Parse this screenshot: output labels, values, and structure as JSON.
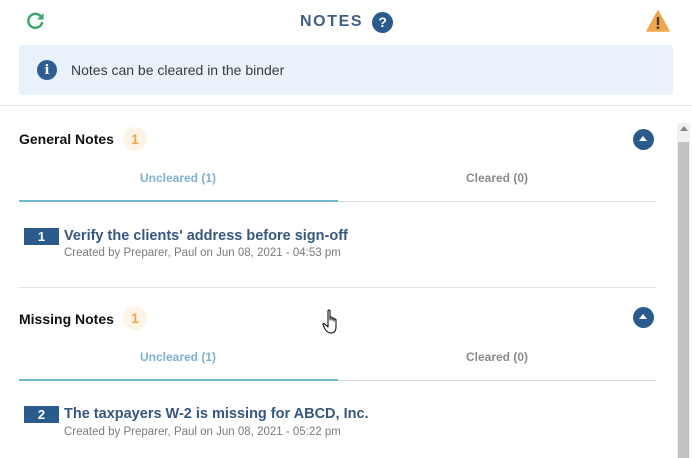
{
  "header": {
    "title": "NOTES",
    "help_icon": "?"
  },
  "banner": {
    "text": "Notes can be cleared in the binder",
    "icon": "i"
  },
  "sections": [
    {
      "title": "General Notes",
      "count": "1",
      "tabs": [
        "Uncleared (1)",
        "Cleared (0)"
      ],
      "active_tab": 0,
      "note": {
        "number": "1",
        "title": "Verify the clients' address before sign-off",
        "meta": "Created by Preparer, Paul on Jun 08, 2021 - 04:53 pm"
      }
    },
    {
      "title": "Missing Notes",
      "count": "1",
      "tabs": [
        "Uncleared (1)",
        "Cleared (0)"
      ],
      "active_tab": 0,
      "note": {
        "number": "2",
        "title": "The taxpayers W-2 is missing for ABCD, Inc.",
        "meta": "Created by Preparer, Paul on Jun 08, 2021 - 05:22 pm"
      }
    }
  ],
  "colors": {
    "accent": "#2b5a8c",
    "warning": "#f0a64a",
    "refresh": "#3aa56a",
    "banner_bg": "#e9f1fb"
  },
  "icons": [
    "refresh-icon",
    "help-icon",
    "warning-icon",
    "info-icon",
    "collapse-icon",
    "hand-cursor-icon"
  ]
}
